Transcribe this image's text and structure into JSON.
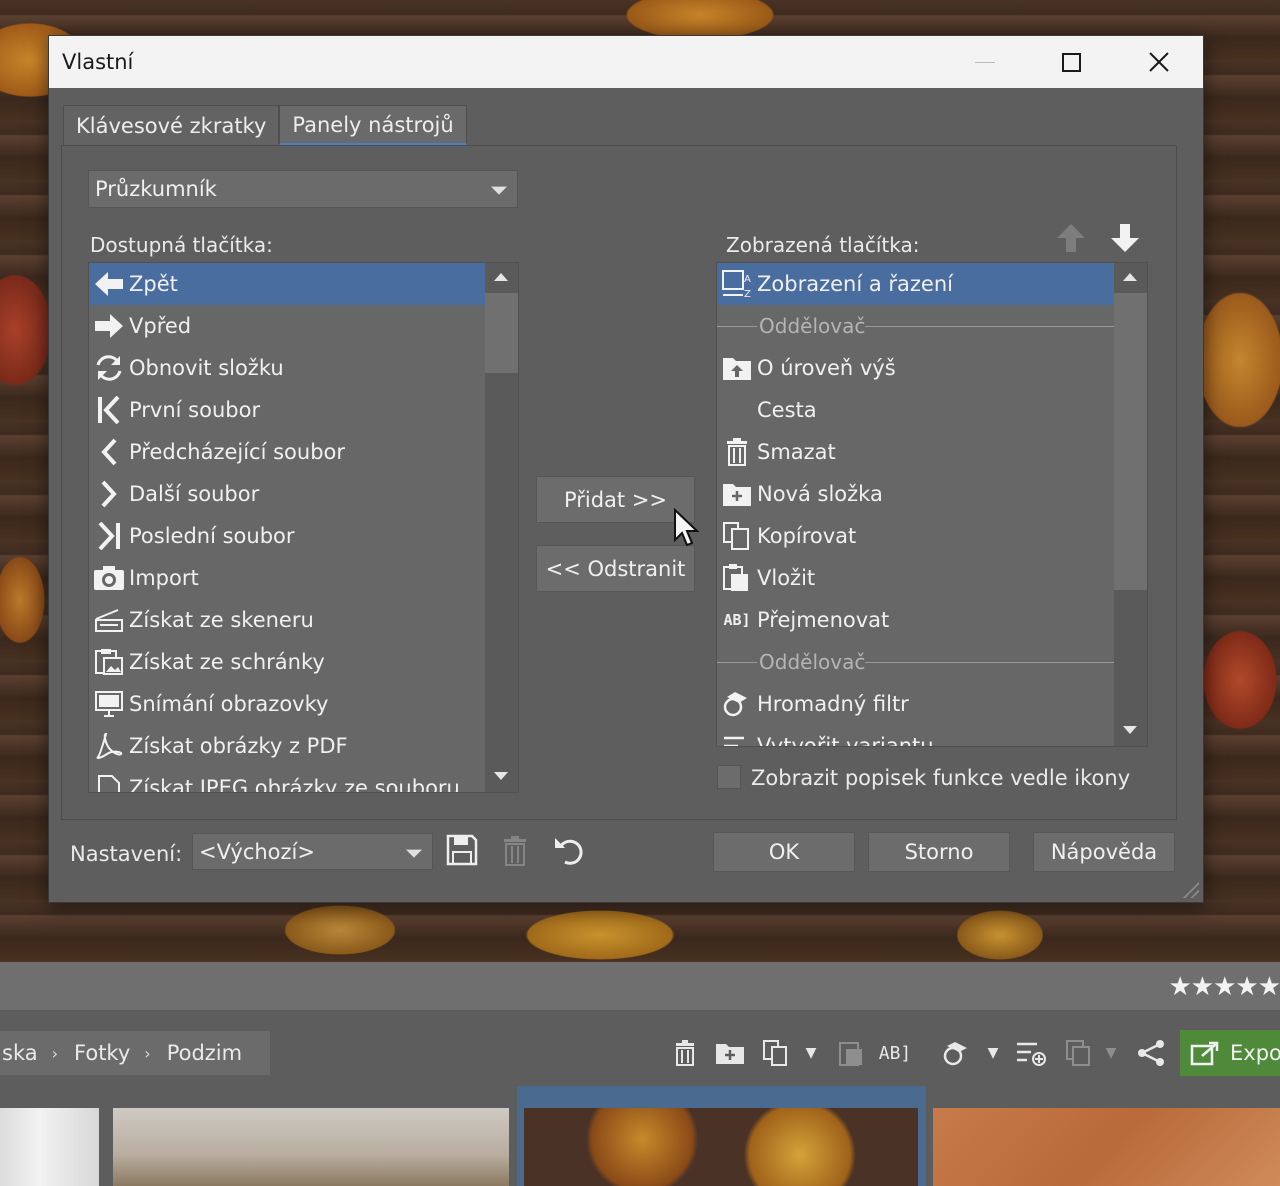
{
  "dialog": {
    "title": "Vlastní",
    "tabs": [
      {
        "label": "Klávesové zkratky",
        "active": false
      },
      {
        "label": "Panely nástrojů",
        "active": true
      }
    ],
    "toolbar_select": {
      "value": "Průzkumník"
    },
    "available": {
      "label": "Dostupná tlačítka:",
      "items": [
        {
          "label": "Zpět",
          "icon": "arrow-left-icon",
          "selected": true
        },
        {
          "label": "Vpřed",
          "icon": "arrow-right-icon"
        },
        {
          "label": "Obnovit složku",
          "icon": "refresh-icon"
        },
        {
          "label": "První soubor",
          "icon": "first-file-icon"
        },
        {
          "label": "Předcházející soubor",
          "icon": "chevron-left-icon"
        },
        {
          "label": "Další soubor",
          "icon": "chevron-right-icon"
        },
        {
          "label": "Poslední soubor",
          "icon": "last-file-icon"
        },
        {
          "label": "Import",
          "icon": "camera-icon"
        },
        {
          "label": "Získat ze skeneru",
          "icon": "scanner-icon"
        },
        {
          "label": "Získat ze schránky",
          "icon": "clipboard-image-icon"
        },
        {
          "label": "Snímání obrazovky",
          "icon": "monitor-icon"
        },
        {
          "label": "Získat obrázky z PDF",
          "icon": "pdf-icon"
        },
        {
          "label": "Získat JPEG obrázky ze souboru",
          "icon": "file-icon"
        }
      ]
    },
    "displayed": {
      "label": "Zobrazená tlačítka:",
      "items": [
        {
          "label": "Zobrazení a řazení",
          "icon": "view-sort-icon",
          "selected": true
        },
        {
          "label": "Oddělovač",
          "separator": true
        },
        {
          "label": "O úroveň výš",
          "icon": "folder-up-icon"
        },
        {
          "label": "Cesta",
          "icon": ""
        },
        {
          "label": "Smazat",
          "icon": "trash-icon"
        },
        {
          "label": "Nová složka",
          "icon": "new-folder-icon"
        },
        {
          "label": "Kopírovat",
          "icon": "copy-icon"
        },
        {
          "label": "Vložit",
          "icon": "paste-icon"
        },
        {
          "label": "Přejmenovat",
          "icon": "rename-icon"
        },
        {
          "label": "Oddělovač",
          "separator": true
        },
        {
          "label": "Hromadný filtr",
          "icon": "batch-filter-icon"
        },
        {
          "label": "Vytvořit variantu",
          "icon": "variant-icon"
        }
      ]
    },
    "add_button": "Přidat >>",
    "remove_button": "<< Odstranit",
    "show_label_checkbox": {
      "label": "Zobrazit popisek funkce vedle ikony",
      "checked": false
    },
    "preset": {
      "label": "Nastavení:",
      "value": "<Výchozí>"
    },
    "ok": "OK",
    "cancel": "Storno",
    "help": "Nápověda"
  },
  "app": {
    "rating": "★★★★★",
    "breadcrumb": [
      "ska",
      "Fotky",
      "Podzim"
    ],
    "export_label": "Expo"
  },
  "colors": {
    "selection": "#4a6da0",
    "dialog_bg": "#5e5e5e",
    "titlebar": "#f3f3f3",
    "export": "#4e8a3a"
  }
}
